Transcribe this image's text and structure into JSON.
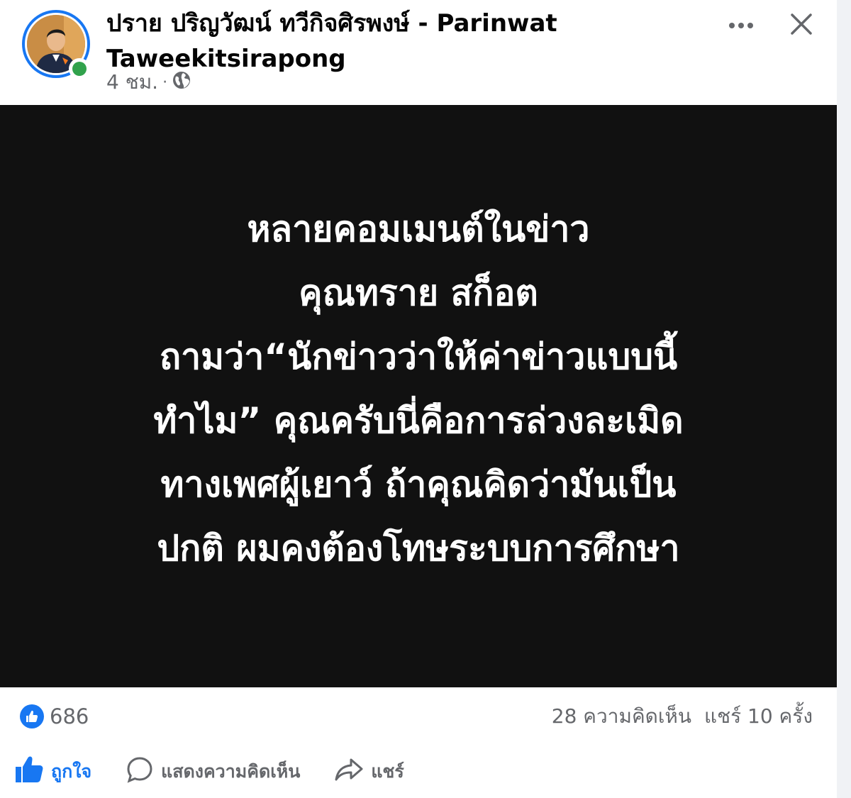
{
  "post": {
    "author_line1": "ปราย ปริญวัฒน์ ทวีกิจศิรพงษ์ - Parinwat",
    "author_line2": "Taweekitsirapong",
    "time": "4 ชม.",
    "separator": "·",
    "privacy_icon": "globe-icon"
  },
  "header": {
    "more_icon": "more-options-icon",
    "close_icon": "close-icon"
  },
  "image_text": {
    "lines": [
      "หลายคอมเมนต์ในข่าว",
      "คุณทราย สก็อต",
      "ถามว่า“นักข่าวว่าให้ค่าข่าวแบบนี้",
      "ทำไม” คุณครับนี่คือการล่วงละเมิด",
      "ทางเพศผู้เยาว์ ถ้าคุณคิดว่ามันเป็น",
      "ปกติ ผมคงต้องโทษระบบการศึกษา"
    ]
  },
  "stats": {
    "reaction_count": "686",
    "comments": "28 ความคิดเห็น",
    "shares": "แชร์ 10 ครั้ง"
  },
  "actions": {
    "like": "ถูกใจ",
    "comment": "แสดงความคิดเห็น",
    "share": "แชร์"
  },
  "colors": {
    "accent": "#1877f2",
    "secondary_text": "#65676b",
    "online": "#31a24c",
    "image_bg": "#111111"
  }
}
